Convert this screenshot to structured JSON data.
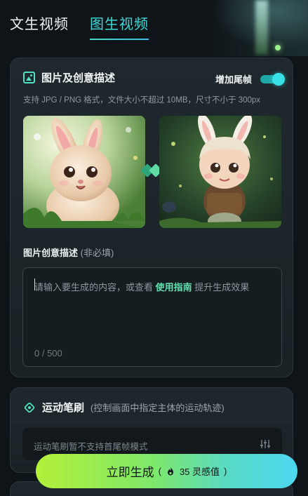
{
  "tabs": [
    {
      "label": "文生视频",
      "active": false
    },
    {
      "label": "图生视频",
      "active": true
    }
  ],
  "image_card": {
    "title": "图片及创意描述",
    "tail_frame_label": "增加尾帧",
    "tail_frame_on": true,
    "format_hint": "支持 JPG / PNG 格式，文件大小不超过 10MB，尺寸不小于 300px",
    "desc_label": "图片创意描述",
    "desc_optional": "(非必填)",
    "placeholder_before": "请输入要生成的内容，或查看",
    "placeholder_link": "使用指南",
    "placeholder_after": "提升生成效果",
    "counter": "0 / 500"
  },
  "brush_card": {
    "title": "运动笔刷",
    "hint": "(控制画面中指定主体的运动轨迹)",
    "note": "运动笔刷暂不支持首尾帧模式"
  },
  "generate": {
    "label": "立即生成",
    "paren_open": "(",
    "cost": "35 灵感值",
    "paren_close": ")"
  },
  "colors": {
    "accent": "#3fd8d8",
    "link": "#5fe0b0",
    "card_bg": "#1f282d"
  }
}
